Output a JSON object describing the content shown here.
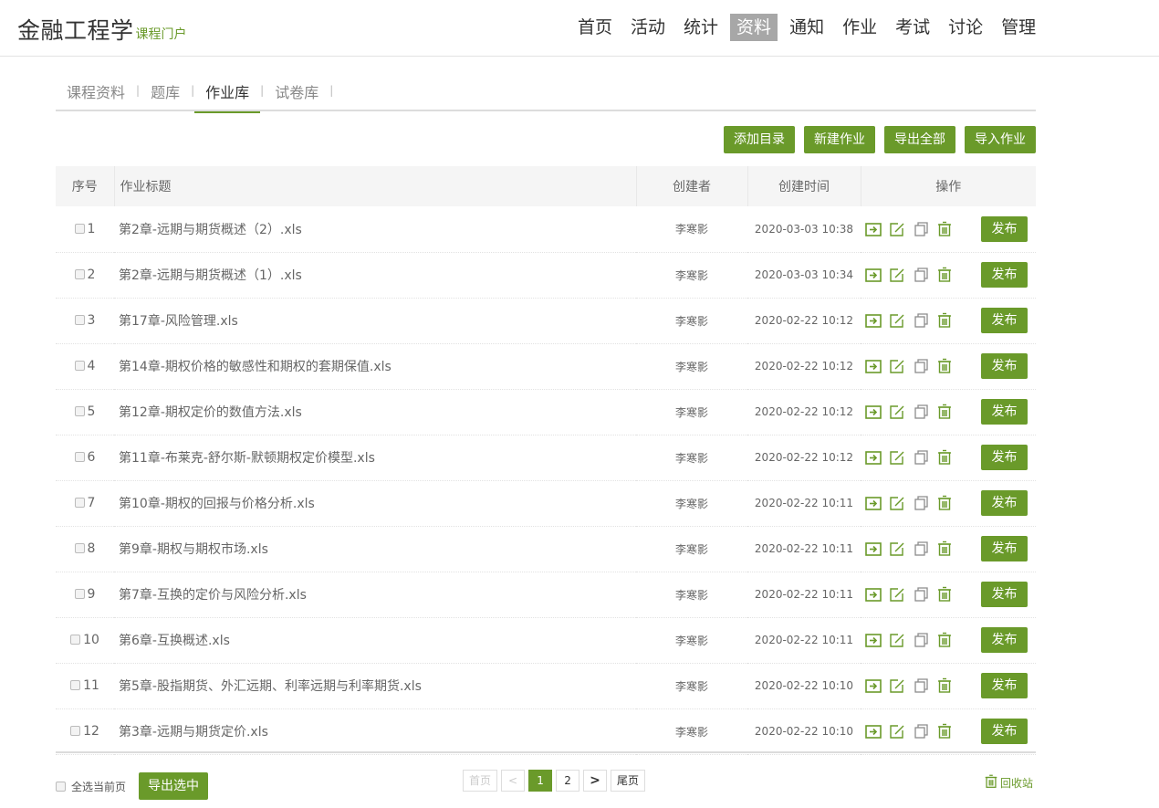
{
  "brand": {
    "title": "金融工程学",
    "subtitle": "课程门户"
  },
  "nav": [
    "首页",
    "活动",
    "统计",
    "资料",
    "通知",
    "作业",
    "考试",
    "讨论",
    "管理"
  ],
  "nav_active": "资料",
  "subtabs": [
    "课程资料",
    "题库",
    "作业库",
    "试卷库"
  ],
  "subtab_active": "作业库",
  "actions": {
    "add_dir": "添加目录",
    "new_hw": "新建作业",
    "export_all": "导出全部",
    "import_hw": "导入作业"
  },
  "table": {
    "headers": {
      "no": "序号",
      "title": "作业标题",
      "author": "创建者",
      "time": "创建时间",
      "ops": "操作"
    },
    "publish_label": "发布",
    "rows": [
      {
        "no": "1",
        "title": "第2章-远期与期货概述（2）.xls",
        "author": "李寒影",
        "time": "2020-03-03 10:38"
      },
      {
        "no": "2",
        "title": "第2章-远期与期货概述（1）.xls",
        "author": "李寒影",
        "time": "2020-03-03 10:34"
      },
      {
        "no": "3",
        "title": "第17章-风险管理.xls",
        "author": "李寒影",
        "time": "2020-02-22 10:12"
      },
      {
        "no": "4",
        "title": "第14章-期权价格的敏感性和期权的套期保值.xls",
        "author": "李寒影",
        "time": "2020-02-22 10:12"
      },
      {
        "no": "5",
        "title": "第12章-期权定价的数值方法.xls",
        "author": "李寒影",
        "time": "2020-02-22 10:12"
      },
      {
        "no": "6",
        "title": "第11章-布莱克-舒尔斯-默顿期权定价模型.xls",
        "author": "李寒影",
        "time": "2020-02-22 10:12"
      },
      {
        "no": "7",
        "title": "第10章-期权的回报与价格分析.xls",
        "author": "李寒影",
        "time": "2020-02-22 10:11"
      },
      {
        "no": "8",
        "title": "第9章-期权与期权市场.xls",
        "author": "李寒影",
        "time": "2020-02-22 10:11"
      },
      {
        "no": "9",
        "title": "第7章-互换的定价与风险分析.xls",
        "author": "李寒影",
        "time": "2020-02-22 10:11"
      },
      {
        "no": "10",
        "title": "第6章-互换概述.xls",
        "author": "李寒影",
        "time": "2020-02-22 10:11"
      },
      {
        "no": "11",
        "title": "第5章-股指期货、外汇远期、利率远期与利率期货.xls",
        "author": "李寒影",
        "time": "2020-02-22 10:10"
      },
      {
        "no": "12",
        "title": "第3章-远期与期货定价.xls",
        "author": "李寒影",
        "time": "2020-02-22 10:10"
      }
    ]
  },
  "footer": {
    "select_all": "全选当前页",
    "export_selected": "导出选中",
    "recycle": "回收站"
  },
  "pager": {
    "first": "首页",
    "prev": "<",
    "pages": [
      "1",
      "2"
    ],
    "current": "1",
    "next": ">",
    "last": "尾页"
  },
  "icons": {
    "move": "move-to-folder-icon",
    "edit": "edit-icon",
    "copy": "copy-icon",
    "delete": "trash-icon"
  },
  "colors": {
    "accent": "#6a9a2a",
    "nav_active_bg": "#a7a7a7"
  }
}
